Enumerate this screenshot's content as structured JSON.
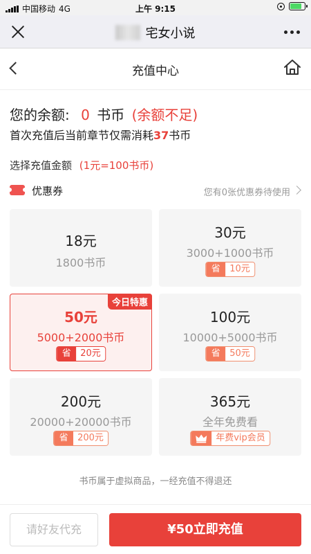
{
  "status_bar": {
    "carrier": "中国移动",
    "network": "4G",
    "time": "上午 9:15",
    "battery_level": 0.8,
    "battery_color": "#4cd964"
  },
  "nav": {
    "title": "宅女小说",
    "close_icon": "close-icon",
    "more_icon": "more-dots-icon"
  },
  "header": {
    "title": "充值中心",
    "back_icon": "chevron-left-icon",
    "home_icon": "home-icon"
  },
  "balance": {
    "label": "您的余额:",
    "value": "0",
    "unit": "书币",
    "status": "(余额不足)"
  },
  "notice": {
    "prefix": "首次充值后当前章节仅需消耗",
    "cost": "37",
    "suffix": "书币"
  },
  "select": {
    "label": "选择充值金额",
    "rate": "(1元=100书币)"
  },
  "coupon": {
    "title": "优惠券",
    "hint": "您有0张优惠券待使用",
    "icon": "coupon-ticket-icon"
  },
  "packages": [
    {
      "price": "18元",
      "coins": "1800书币",
      "tag": "",
      "discount": "",
      "selected": false
    },
    {
      "price": "30元",
      "coins": "3000+1000书币",
      "tag": "省",
      "discount": "10元",
      "selected": false
    },
    {
      "price": "50元",
      "coins": "5000+2000书币",
      "tag": "省",
      "discount": "20元",
      "selected": true,
      "ribbon": "今日特惠"
    },
    {
      "price": "100元",
      "coins": "10000+5000书币",
      "tag": "省",
      "discount": "50元",
      "selected": false
    },
    {
      "price": "200元",
      "coins": "20000+20000书币",
      "tag": "省",
      "discount": "200元",
      "selected": false
    },
    {
      "price": "365元",
      "coins": "全年免费看",
      "tag": "crown-icon",
      "discount": "年费vip会员",
      "selected": false
    }
  ],
  "disclaimer": "书币属于虚拟商品，一经充值不得退还",
  "bottom": {
    "friend_label": "请好友代充",
    "pay_label": "¥50立即充值"
  },
  "colors": {
    "accent": "#e8413a",
    "badge": "#f47a5c"
  }
}
